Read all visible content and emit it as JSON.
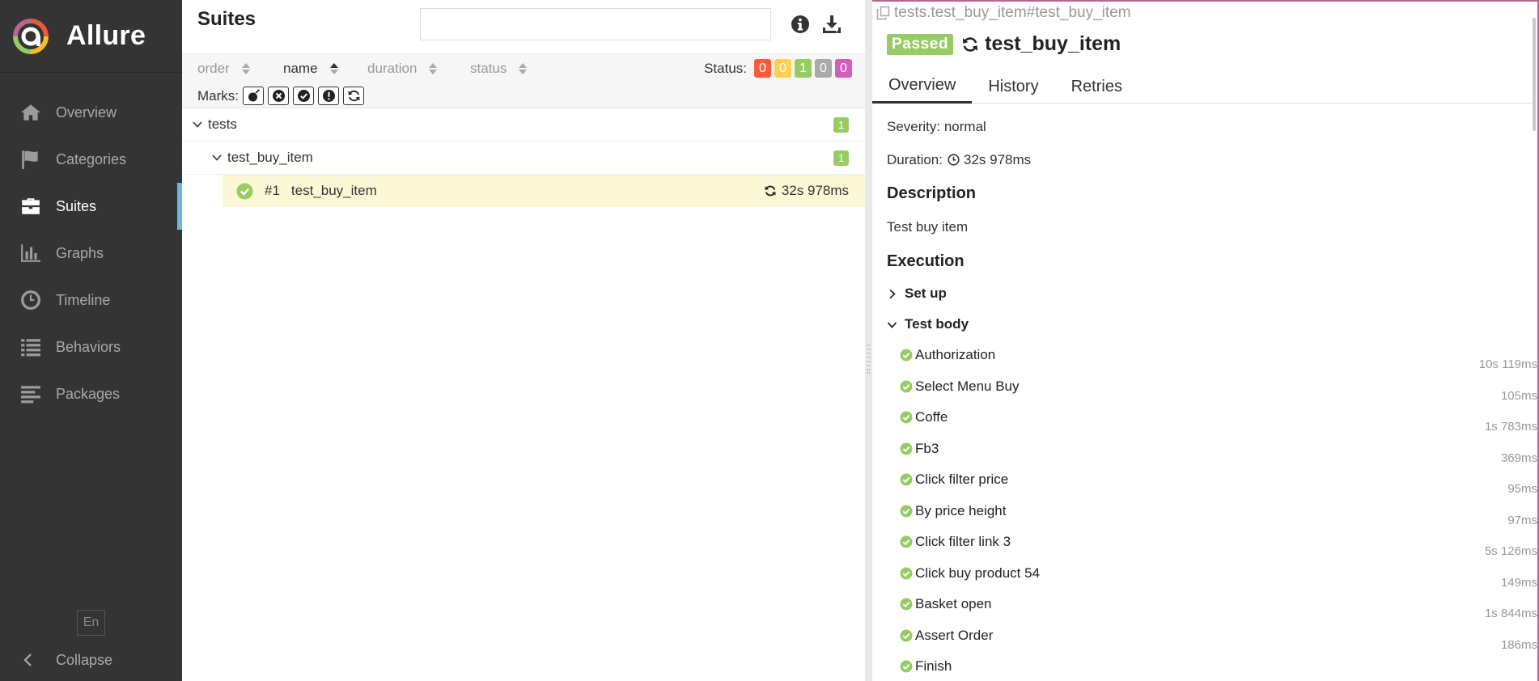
{
  "app": {
    "name": "Allure"
  },
  "sidebar": {
    "items": [
      {
        "label": "Overview",
        "icon": "home-icon",
        "active": false
      },
      {
        "label": "Categories",
        "icon": "flag-icon",
        "active": false
      },
      {
        "label": "Suites",
        "icon": "briefcase-icon",
        "active": true
      },
      {
        "label": "Graphs",
        "icon": "bar-chart-icon",
        "active": false
      },
      {
        "label": "Timeline",
        "icon": "clock-icon",
        "active": false
      },
      {
        "label": "Behaviors",
        "icon": "list-icon",
        "active": false
      },
      {
        "label": "Packages",
        "icon": "align-left-icon",
        "active": false
      }
    ],
    "language": "En",
    "collapse_label": "Collapse"
  },
  "suites": {
    "title": "Suites",
    "search": {
      "value": "",
      "placeholder": ""
    },
    "sort": {
      "order": "order",
      "name": "name",
      "duration": "duration",
      "status": "status",
      "active": "name"
    },
    "status_label": "Status:",
    "status_counts": [
      {
        "value": "0",
        "color": "#fd5a3e",
        "status": "failed"
      },
      {
        "value": "0",
        "color": "#ffd050",
        "status": "broken"
      },
      {
        "value": "1",
        "color": "#97cc64",
        "status": "passed"
      },
      {
        "value": "0",
        "color": "#aaaaaa",
        "status": "skipped"
      },
      {
        "value": "0",
        "color": "#d35ebe",
        "status": "unknown"
      }
    ],
    "marks_label": "Marks:",
    "marks": [
      "flaky-bomb-icon",
      "new-failed-icon",
      "new-passed-icon",
      "new-broken-icon",
      "retries-icon"
    ],
    "tree": {
      "root": {
        "name": "tests",
        "count": "1"
      },
      "child": {
        "name": "test_buy_item",
        "count": "1"
      },
      "test": {
        "order": "#1",
        "name": "test_buy_item",
        "duration": "32s 978ms",
        "status": "passed"
      }
    }
  },
  "test_result": {
    "full_name": "tests.test_buy_item#test_buy_item",
    "status_label": "Passed",
    "status_color": "#97cc64",
    "name": "test_buy_item",
    "tabs": [
      "Overview",
      "History",
      "Retries"
    ],
    "active_tab": "Overview",
    "severity": "Severity: normal",
    "duration_label": "Duration:",
    "duration": "32s 978ms",
    "description_title": "Description",
    "description": "Test buy item",
    "execution_title": "Execution",
    "setup_label": "Set up",
    "body_label": "Test body",
    "steps": [
      {
        "name": "Authorization",
        "duration": "10s 119ms"
      },
      {
        "name": "Select Menu Buy",
        "duration": "105ms"
      },
      {
        "name": "Coffe",
        "duration": "1s 783ms"
      },
      {
        "name": "Fb3",
        "duration": "369ms"
      },
      {
        "name": "Click filter price",
        "duration": "95ms"
      },
      {
        "name": "By price height",
        "duration": "97ms"
      },
      {
        "name": "Click filter link 3",
        "duration": "5s 126ms"
      },
      {
        "name": "Click buy product 54",
        "duration": "149ms"
      },
      {
        "name": "Basket open",
        "duration": "1s 844ms"
      },
      {
        "name": "Assert Order",
        "duration": "186ms"
      },
      {
        "name": "Finish",
        "duration": ""
      }
    ]
  }
}
